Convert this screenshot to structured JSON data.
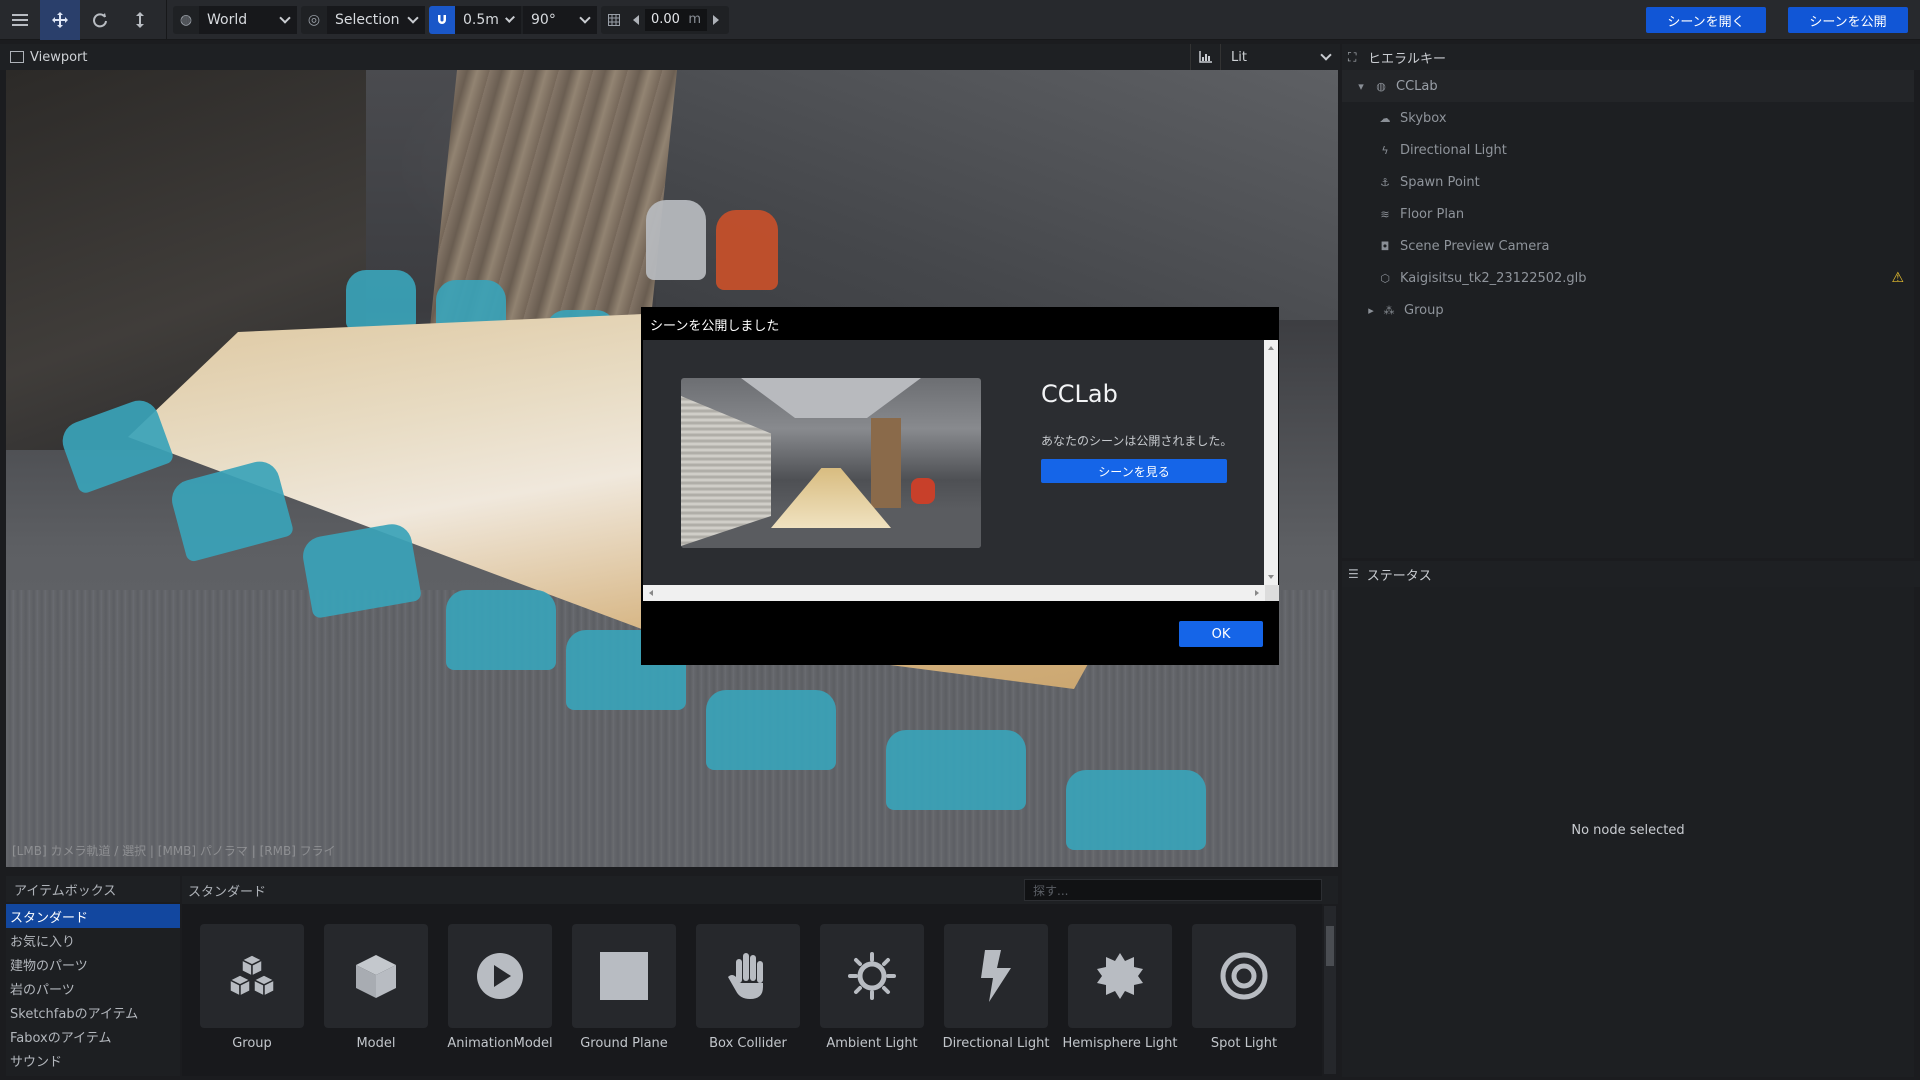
{
  "toolbar": {
    "space": "World",
    "pivot": "Selection",
    "snap_translate": "0.5m",
    "snap_rotate": "90°",
    "grid_value": "0.00",
    "grid_unit": "m",
    "open_scene_label": "シーンを開く",
    "publish_scene_label": "シーンを公開"
  },
  "viewport": {
    "title": "Viewport",
    "render_mode": "Lit",
    "hint": "[LMB] カメラ軌道 / 選択 | [MMB] パノラマ | [RMB] フライ"
  },
  "hierarchy": {
    "title": "ヒエラルキー",
    "root": "CCLab",
    "items": [
      {
        "label": "Skybox",
        "icon": "cloud-icon"
      },
      {
        "label": "Directional Light",
        "icon": "bolt-icon"
      },
      {
        "label": "Spawn Point",
        "icon": "spawn-icon"
      },
      {
        "label": "Floor Plan",
        "icon": "floor-plan-icon"
      },
      {
        "label": "Scene Preview Camera",
        "icon": "camera-icon"
      },
      {
        "label": "Kaigisitsu_tk2_23122502.glb",
        "icon": "model-icon",
        "warning": true
      },
      {
        "label": "Group",
        "icon": "group-icon"
      }
    ]
  },
  "status": {
    "title": "ステータス",
    "empty_text": "No node selected"
  },
  "itembox": {
    "title": "アイテムボックス",
    "categories": [
      "スタンダード",
      "お気に入り",
      "建物のパーツ",
      "岩のパーツ",
      "Sketchfabのアイテム",
      "Faboxのアイテム",
      "サウンド"
    ],
    "active_category": "スタンダード",
    "section_title": "スタンダード",
    "search_placeholder": "探す...",
    "items": [
      "Group",
      "Model",
      "AnimationModel",
      "Ground Plane",
      "Box Collider",
      "Ambient Light",
      "Directional Light",
      "Hemisphere Light",
      "Spot Light"
    ]
  },
  "modal": {
    "title": "シーンを公開しました",
    "scene_name": "CCLab",
    "message": "あなたのシーンは公開されました。",
    "view_button": "シーンを見る",
    "ok_button": "OK"
  }
}
